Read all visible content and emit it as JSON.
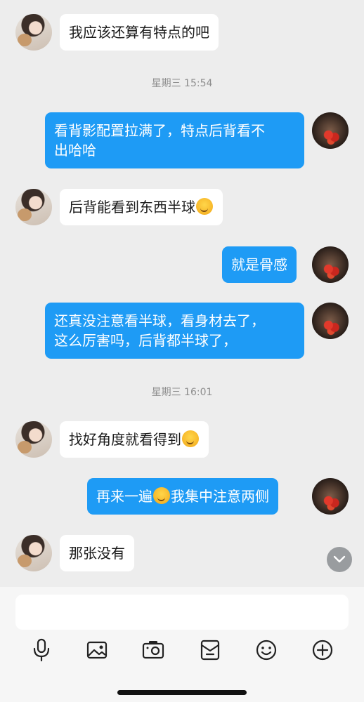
{
  "messages": [
    {
      "side": "in",
      "text": "我应该还算有特点的吧"
    },
    {
      "type": "timestamp",
      "text": "星期三 15:54"
    },
    {
      "side": "out",
      "line1": "看背影配置拉满了，特点后背看不",
      "line2": "出哈哈"
    },
    {
      "side": "in",
      "text": "后背能看到东西半球",
      "emoji": "shy-face-emoji"
    },
    {
      "side": "out",
      "text": "就是骨感"
    },
    {
      "side": "out",
      "line1": "还真没注意看半球，看身材去了，",
      "line2": "这么厉害吗，后背都半球了，"
    },
    {
      "type": "timestamp",
      "text": "星期三 16:01"
    },
    {
      "side": "in",
      "text": "找好角度就看得到",
      "emoji": "shy-face-emoji"
    },
    {
      "side": "out",
      "before": "再来一遍",
      "after": "我集中注意两侧",
      "emoji": "shy-face-emoji"
    },
    {
      "side": "in",
      "text": "那张没有"
    }
  ],
  "composer": {
    "input_value": "",
    "tools": [
      "microphone-icon",
      "image-icon",
      "camera-icon",
      "wallet-icon",
      "emoji-icon",
      "plus-icon"
    ]
  },
  "colors": {
    "background": "#ededed",
    "outgoing_bubble": "#1e9bf5",
    "incoming_bubble": "#ffffff",
    "timestamp": "#8e8e8e"
  }
}
